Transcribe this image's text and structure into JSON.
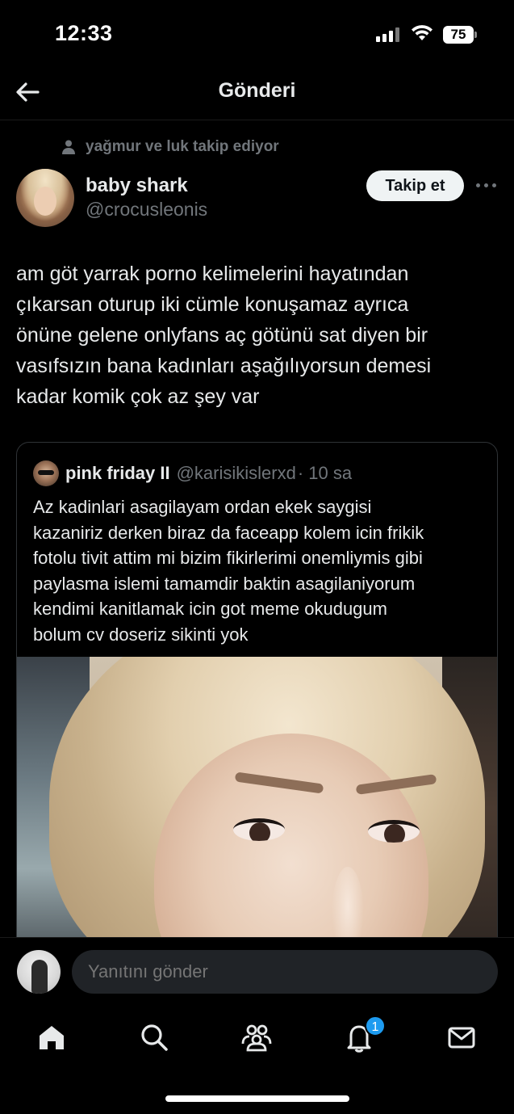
{
  "status_bar": {
    "time": "12:33",
    "battery": "75"
  },
  "header": {
    "title": "Gönderi"
  },
  "post": {
    "social_context": "yağmur ve luk takip ediyor",
    "author": {
      "display_name": "baby shark",
      "handle": "@crocusleonis"
    },
    "follow_label": "Takip et",
    "text_lines": [
      "am göt yarrak porno kelimelerini hayatından",
      "çıkarsan oturup iki cümle konuşamaz ayrıca",
      "önüne gelene onlyfans aç götünü sat diyen bir",
      "vasıfsızın bana kadınları aşağılıyorsun demesi",
      "kadar komik çok az şey var"
    ],
    "quote": {
      "display_name": "pink friday II",
      "handle": "@karisikislerxd",
      "time": "· 10 sa",
      "text_lines": [
        "Az kadinlari asagilayam ordan ekek saygisi",
        "kazaniriz derken biraz da faceapp kolem icin frikik",
        "fotolu tivit attim mi bizim fikirlerimi onemliymis gibi",
        "paylasma islemi tamamdir baktin asagilaniyorum",
        "kendimi kanitlamak icin got meme okudugum",
        "bolum cv doseriz sikinti yok"
      ]
    }
  },
  "reply": {
    "placeholder": "Yanıtını gönder"
  },
  "tabbar": {
    "items": [
      "home-icon",
      "search-icon",
      "communities-icon",
      "notifications-icon",
      "messages-icon"
    ],
    "notification_count": "1"
  },
  "colors": {
    "background": "#000000",
    "text_primary": "#e7e9ea",
    "text_secondary": "#71767b",
    "accent": "#1d9bf0",
    "border": "#2f3336"
  }
}
